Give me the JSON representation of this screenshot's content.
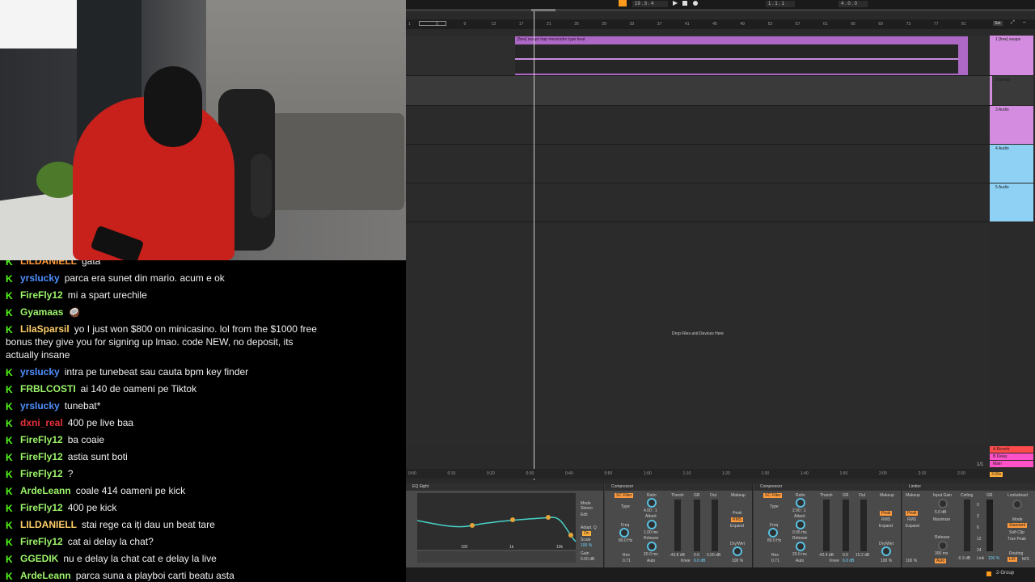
{
  "chat": {
    "messages": [
      {
        "user": "LILDANIELL",
        "color": "#ff9a3c",
        "text": "gata"
      },
      {
        "user": "yrslucky",
        "color": "#4f8fff",
        "text": "parca era sunet din mario. acum e ok"
      },
      {
        "user": "FireFly12",
        "color": "#9cf46a",
        "text": "mi a spart urechile"
      },
      {
        "user": "Gyamaas",
        "color": "#9cf46a",
        "text": "🥥"
      },
      {
        "user": "LilaSparsil",
        "color": "#ffcf6a",
        "text": "yo I just won $800 on minicasino. lol from the $1000 free bonus they give you for signing up lmao. code NEW, no deposit, its actually insane"
      },
      {
        "user": "yrslucky",
        "color": "#4f8fff",
        "text": "intra pe tunebeat sau cauta bpm key finder"
      },
      {
        "user": "FRBLCOSTI",
        "color": "#9cf46a",
        "text": "ai 140 de oameni pe Tiktok"
      },
      {
        "user": "yrslucky",
        "color": "#4f8fff",
        "text": "tunebat*"
      },
      {
        "user": "dxni_real",
        "color": "#e8313c",
        "text": "400 pe live baa"
      },
      {
        "user": "FireFly12",
        "color": "#9cf46a",
        "text": "ba coaie"
      },
      {
        "user": "FireFly12",
        "color": "#9cf46a",
        "text": "astia sunt boti"
      },
      {
        "user": "FireFly12",
        "color": "#9cf46a",
        "text": "?"
      },
      {
        "user": "ArdeLeann",
        "color": "#9cf46a",
        "text": "coale 414 oameni pe kick"
      },
      {
        "user": "FireFly12",
        "color": "#9cf46a",
        "text": "400 pe kick"
      },
      {
        "user": "LILDANIELL",
        "color": "#ffcf6a",
        "text": "stai rege ca iți dau un beat tare"
      },
      {
        "user": "FireFly12",
        "color": "#9cf46a",
        "text": "cat ai delay la chat?"
      },
      {
        "user": "GGEDIK",
        "color": "#9cf46a",
        "text": "nu e delay la chat cat e delay la live"
      },
      {
        "user": "ArdeLeann",
        "color": "#9cf46a",
        "text": "parca suna a playboi carti beatu asta"
      }
    ]
  },
  "daw": {
    "transport": {
      "position": "19 . 3 . 4",
      "loop_start": "1 . 1 . 1",
      "loop_length": "4 . 0 . 0"
    },
    "ruler_marks": [
      "1",
      "5",
      "9",
      "13",
      "17",
      "21",
      "25",
      "29",
      "33",
      "37",
      "41",
      "45",
      "49",
      "53",
      "57",
      "61",
      "65",
      "69",
      "73",
      "77",
      "81"
    ],
    "time_marks": [
      "0:00",
      "0:10",
      "0:20",
      "0:30",
      "0:40",
      "0:50",
      "1:00",
      "1:10",
      "1:20",
      "1:30",
      "1:40",
      "1:50",
      "2:00",
      "2:10",
      "2:20"
    ],
    "clip_name": "[free] swaps trap mexicodro type beat",
    "drop_text": "Drop Files and Devices Here",
    "set_label": "Set",
    "tracks": [
      {
        "name": "1 [free] swaps",
        "color": "#d38ce0"
      },
      {
        "name": "2 Group",
        "color": "#d38ce0"
      },
      {
        "name": "3 Audio",
        "color": "#d38ce0"
      },
      {
        "name": "4 Audio",
        "color": "#8fd0f5"
      },
      {
        "name": "5 Audio",
        "color": "#8fd0f5"
      }
    ],
    "returns": [
      {
        "name": "A Reverb",
        "color": "#ff4b4b"
      },
      {
        "name": "B Delay",
        "color": "#ff52c8"
      },
      {
        "name": "Main",
        "color": "#ff52c8"
      }
    ],
    "page_indicator": "1/1",
    "zoom_indicator": "3.00x",
    "devices": {
      "eq": {
        "title": "EQ Eight",
        "mode_label": "Mode",
        "mode_value": "Stereo",
        "edit_label": "Edit",
        "adapt_label": "Adapt. Q",
        "adapt_value": "On",
        "scale_label": "Scale",
        "scale_value": "100 %",
        "gain_label": "Gain",
        "gain_value": "0.00 dB",
        "freq_100": "100",
        "freq_1k": "1k",
        "freq_10k": "10k"
      },
      "comp1": {
        "title": "Compressor",
        "sc_filter": "SC Filter",
        "ratio_label": "Ratio",
        "ratio_value": "4.00 : 1",
        "attack_label": "Attack",
        "attack_value": "1.00 ms",
        "release_label": "Release",
        "release_value": "20.0 ms",
        "thresh_label": "Thresh",
        "gr_label": "GR",
        "out_label": "Out",
        "thresh_value": "-43.8 dB",
        "gr_value": "0.0",
        "out_value": "0.00 dB",
        "makeup_label": "Makeup",
        "peak_label": "Peak",
        "rms_label": "RMS",
        "expand_label": "Expand",
        "type_label": "Type",
        "freq_label": "Freq",
        "freq_value": "80.0 Hz",
        "res_label": "Res",
        "res_value": "0.71",
        "drywet_label": "Dry/Wet",
        "drywet_value": "100 %",
        "knee_label": "Knee",
        "knee_value": "6.0 dB",
        "auto_label": "Auto"
      },
      "comp2": {
        "title": "Compressor",
        "ratio_value": "2.00 : 1",
        "attack_value": "0.05 ms",
        "release_value": "20.0 ms",
        "thresh_value": "-42.4 dB",
        "gr_value": "0.0",
        "out_value": "15.2 dB",
        "freq_value": "80.0 Hz",
        "res_value": "0.71",
        "drywet_value": "100 %",
        "knee_value": "6.0 dB"
      },
      "limiter": {
        "title": "Limiter",
        "makeup_label": "Makeup",
        "input_gain_label": "Input Gain",
        "input_gain_value": "5.0 dB",
        "maximize_label": "Maximize",
        "release_label": "Release",
        "release_value": "300 ms",
        "auto_label": "Auto",
        "ceiling_label": "Ceiling",
        "ceiling_value": "-0.3 dB",
        "gr_label": "GR",
        "link_label": "Link",
        "link_value": "100 %",
        "lookahead_label": "Lookahead",
        "mode_label": "Mode",
        "mode_value": "Standard",
        "softclip_label": "Soft Clip",
        "truepeak_label": "True Peak",
        "routing_label": "Routing",
        "routing_value": "L/R",
        "ms_label": "M/S",
        "scale": [
          "0",
          "3",
          "6",
          "12",
          "24"
        ]
      }
    },
    "status_group": "2-Group"
  }
}
